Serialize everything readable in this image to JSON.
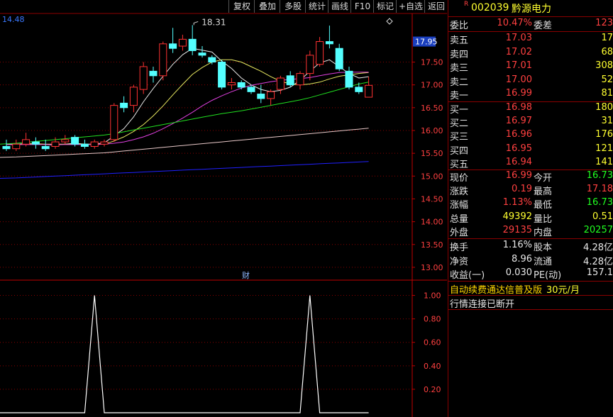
{
  "toolbar": {
    "buttons": [
      "复权",
      "叠加",
      "多股",
      "统计",
      "画线",
      "F10",
      "标记",
      "+自选",
      "返回"
    ]
  },
  "main_chart": {
    "top_left_value": "14.48",
    "peak_label": "18.31",
    "cursor_price": "17.95",
    "cai_label": "财",
    "y_ticks": [
      "17.50",
      "17.00",
      "16.50",
      "16.00",
      "15.50",
      "15.00",
      "14.50",
      "14.00",
      "13.50",
      "13.00"
    ],
    "ylim": [
      12.75,
      18.55
    ]
  },
  "sub_chart": {
    "y_ticks": [
      "1.00",
      "0.80",
      "0.60",
      "0.40",
      "0.20"
    ],
    "ylim": [
      0,
      1.1
    ]
  },
  "chart_data": {
    "type": "candlestick",
    "candles": [
      {
        "o": 15.65,
        "h": 15.8,
        "l": 15.55,
        "c": 15.6
      },
      {
        "o": 15.6,
        "h": 15.8,
        "l": 15.55,
        "c": 15.7
      },
      {
        "o": 15.7,
        "h": 15.95,
        "l": 15.65,
        "c": 15.8
      },
      {
        "o": 15.75,
        "h": 15.85,
        "l": 15.6,
        "c": 15.7
      },
      {
        "o": 15.65,
        "h": 15.8,
        "l": 15.55,
        "c": 15.6
      },
      {
        "o": 15.65,
        "h": 15.85,
        "l": 15.6,
        "c": 15.75
      },
      {
        "o": 15.75,
        "h": 15.9,
        "l": 15.7,
        "c": 15.8
      },
      {
        "o": 15.85,
        "h": 15.9,
        "l": 15.65,
        "c": 15.7
      },
      {
        "o": 15.7,
        "h": 15.8,
        "l": 15.6,
        "c": 15.65
      },
      {
        "o": 15.65,
        "h": 15.8,
        "l": 15.6,
        "c": 15.75
      },
      {
        "o": 15.7,
        "h": 15.8,
        "l": 15.65,
        "c": 15.75
      },
      {
        "o": 15.8,
        "h": 16.6,
        "l": 15.75,
        "c": 16.55
      },
      {
        "o": 16.6,
        "h": 16.75,
        "l": 16.4,
        "c": 16.5
      },
      {
        "o": 16.55,
        "h": 17.0,
        "l": 16.4,
        "c": 16.95
      },
      {
        "o": 16.9,
        "h": 17.5,
        "l": 16.8,
        "c": 17.4
      },
      {
        "o": 17.3,
        "h": 17.4,
        "l": 17.05,
        "c": 17.2
      },
      {
        "o": 17.2,
        "h": 17.95,
        "l": 17.1,
        "c": 17.9
      },
      {
        "o": 17.9,
        "h": 18.25,
        "l": 17.7,
        "c": 17.8
      },
      {
        "o": 17.85,
        "h": 18.1,
        "l": 17.75,
        "c": 18.0
      },
      {
        "o": 18.0,
        "h": 18.31,
        "l": 17.65,
        "c": 17.75
      },
      {
        "o": 17.7,
        "h": 17.85,
        "l": 17.6,
        "c": 17.65
      },
      {
        "o": 17.6,
        "h": 17.65,
        "l": 17.45,
        "c": 17.5
      },
      {
        "o": 17.5,
        "h": 17.55,
        "l": 16.9,
        "c": 16.95
      },
      {
        "o": 17.0,
        "h": 17.15,
        "l": 16.9,
        "c": 17.05
      },
      {
        "o": 17.05,
        "h": 17.1,
        "l": 16.9,
        "c": 16.95
      },
      {
        "o": 16.95,
        "h": 17.0,
        "l": 16.8,
        "c": 16.85
      },
      {
        "o": 16.8,
        "h": 17.0,
        "l": 16.6,
        "c": 16.7
      },
      {
        "o": 16.7,
        "h": 16.9,
        "l": 16.55,
        "c": 16.85
      },
      {
        "o": 16.9,
        "h": 17.2,
        "l": 16.8,
        "c": 17.15
      },
      {
        "o": 17.2,
        "h": 17.3,
        "l": 16.95,
        "c": 17.0
      },
      {
        "o": 17.0,
        "h": 17.3,
        "l": 16.9,
        "c": 17.25
      },
      {
        "o": 17.25,
        "h": 17.75,
        "l": 17.1,
        "c": 17.65
      },
      {
        "o": 17.45,
        "h": 18.05,
        "l": 17.4,
        "c": 17.95
      },
      {
        "o": 17.95,
        "h": 18.3,
        "l": 17.8,
        "c": 17.9
      },
      {
        "o": 17.8,
        "h": 17.9,
        "l": 17.3,
        "c": 17.35
      },
      {
        "o": 17.3,
        "h": 17.4,
        "l": 16.9,
        "c": 16.95
      },
      {
        "o": 16.95,
        "h": 17.05,
        "l": 16.8,
        "c": 16.85
      },
      {
        "o": 16.73,
        "h": 17.18,
        "l": 16.73,
        "c": 16.99
      }
    ],
    "ma": [
      {
        "name": "MA5",
        "color": "#e8e8e8",
        "values": [
          15.7,
          15.7,
          15.71,
          15.71,
          15.69,
          15.68,
          15.7,
          15.72,
          15.7,
          15.7,
          15.73,
          15.88,
          16.04,
          16.3,
          16.63,
          16.92,
          17.19,
          17.45,
          17.66,
          17.8,
          17.76,
          17.72,
          17.52,
          17.36,
          17.15,
          17.0,
          16.9,
          16.85,
          16.88,
          16.95,
          17.1,
          17.3,
          17.48,
          17.55,
          17.4,
          17.25,
          17.15,
          17.18
        ]
      },
      {
        "name": "MA10",
        "color": "#e8e860",
        "values": [
          15.69,
          15.69,
          15.7,
          15.71,
          15.7,
          15.7,
          15.7,
          15.7,
          15.7,
          15.69,
          15.7,
          15.77,
          15.86,
          15.98,
          16.13,
          16.32,
          16.54,
          16.78,
          17.01,
          17.23,
          17.38,
          17.5,
          17.55,
          17.55,
          17.5,
          17.4,
          17.3,
          17.18,
          17.08,
          17.02,
          17.0,
          17.02,
          17.06,
          17.13,
          17.19,
          17.22,
          17.25,
          17.27
        ]
      },
      {
        "name": "MA20",
        "color": "#e040e0",
        "values": [
          15.69,
          15.69,
          15.69,
          15.69,
          15.69,
          15.69,
          15.69,
          15.69,
          15.69,
          15.69,
          15.7,
          15.72,
          15.75,
          15.8,
          15.86,
          15.94,
          16.04,
          16.15,
          16.27,
          16.4,
          16.54,
          16.66,
          16.76,
          16.85,
          16.93,
          16.99,
          17.03,
          17.07,
          17.1,
          17.12,
          17.14,
          17.16,
          17.2,
          17.24,
          17.27,
          17.28,
          17.28,
          17.28
        ]
      },
      {
        "name": "MA60",
        "color": "#20e020",
        "values": [
          15.7,
          15.72,
          15.74,
          15.76,
          15.78,
          15.8,
          15.82,
          15.84,
          15.86,
          15.88,
          15.9,
          15.93,
          15.97,
          16.01,
          16.05,
          16.09,
          16.13,
          16.17,
          16.21,
          16.25,
          16.29,
          16.33,
          16.37,
          16.4,
          16.43,
          16.47,
          16.51,
          16.55,
          16.59,
          16.63,
          16.67,
          16.72,
          16.78,
          16.84,
          16.9,
          16.96,
          17.02,
          17.06
        ]
      },
      {
        "name": "MA120",
        "color": "#e8c8c8",
        "values": [
          15.41,
          15.42,
          15.43,
          15.44,
          15.45,
          15.46,
          15.47,
          15.48,
          15.49,
          15.5,
          15.51,
          15.53,
          15.55,
          15.57,
          15.59,
          15.61,
          15.63,
          15.65,
          15.67,
          15.69,
          15.71,
          15.73,
          15.75,
          15.77,
          15.79,
          15.81,
          15.83,
          15.85,
          15.87,
          15.89,
          15.91,
          15.93,
          15.95,
          15.97,
          15.99,
          16.01,
          16.03,
          16.05
        ]
      },
      {
        "name": "MA250",
        "color": "#2020ff",
        "values": [
          14.95,
          14.96,
          14.97,
          14.98,
          14.99,
          15.0,
          15.01,
          15.02,
          15.03,
          15.04,
          15.05,
          15.06,
          15.07,
          15.08,
          15.09,
          15.1,
          15.11,
          15.12,
          15.13,
          15.14,
          15.15,
          15.16,
          15.17,
          15.18,
          15.19,
          15.2,
          15.21,
          15.22,
          15.23,
          15.24,
          15.25,
          15.26,
          15.27,
          15.28,
          15.29,
          15.3,
          15.31,
          15.32
        ]
      }
    ],
    "indicator": [
      0,
      0,
      0,
      0,
      0,
      0,
      0,
      0,
      0,
      1,
      0,
      0,
      0,
      0,
      0,
      0,
      0,
      0,
      0,
      0,
      0,
      0,
      0,
      0,
      0,
      0,
      0,
      0,
      0,
      0,
      0,
      1,
      0,
      0,
      0,
      0,
      0,
      0
    ]
  },
  "quote": {
    "code": "002039",
    "name": "黔源电力",
    "r_mark": "R",
    "weibi_label": "委比",
    "weibi": "10.47%",
    "weicha_label": "委差",
    "weicha": "123",
    "sells": [
      {
        "label": "卖五",
        "price": "17.03",
        "vol": "17"
      },
      {
        "label": "卖四",
        "price": "17.02",
        "vol": "68"
      },
      {
        "label": "卖三",
        "price": "17.01",
        "vol": "308"
      },
      {
        "label": "卖二",
        "price": "17.00",
        "vol": "52"
      },
      {
        "label": "卖一",
        "price": "16.99",
        "vol": "81"
      }
    ],
    "buys": [
      {
        "label": "买一",
        "price": "16.98",
        "vol": "180"
      },
      {
        "label": "买二",
        "price": "16.97",
        "vol": "31"
      },
      {
        "label": "买三",
        "price": "16.96",
        "vol": "176"
      },
      {
        "label": "买四",
        "price": "16.95",
        "vol": "121"
      },
      {
        "label": "买五",
        "price": "16.94",
        "vol": "141"
      }
    ],
    "stats": [
      {
        "l1": "现价",
        "v1": "16.99",
        "c1": "red",
        "l2": "今开",
        "v2": "16.73",
        "c2": "grn"
      },
      {
        "l1": "涨跌",
        "v1": "0.19",
        "c1": "red",
        "l2": "最高",
        "v2": "17.18",
        "c2": "red"
      },
      {
        "l1": "涨幅",
        "v1": "1.13%",
        "c1": "red",
        "l2": "最低",
        "v2": "16.73",
        "c2": "grn"
      },
      {
        "l1": "总量",
        "v1": "49392",
        "c1": "yel",
        "l2": "量比",
        "v2": "0.51",
        "c2": "yel"
      },
      {
        "l1": "外盘",
        "v1": "29135",
        "c1": "red",
        "l2": "内盘",
        "v2": "20257",
        "c2": "grn"
      }
    ],
    "fund": [
      {
        "l1": "换手",
        "v1": "1.16%",
        "l2": "股本",
        "v2": "4.28亿"
      },
      {
        "l1": "净资",
        "v1": "8.96",
        "l2": "流通",
        "v2": "4.28亿"
      },
      {
        "l1": "收益(一)",
        "v1": "0.030",
        "l2": "PE(动)",
        "v2": "157.1"
      }
    ],
    "ad_text": "自动续费通达信普及版",
    "ad_price": "30元/月",
    "disconnect": "行情连接已断开"
  },
  "colors": {
    "up": "#ff3232",
    "down": "#54ffff",
    "grid": "#8a0000",
    "axis": "#c00000"
  }
}
